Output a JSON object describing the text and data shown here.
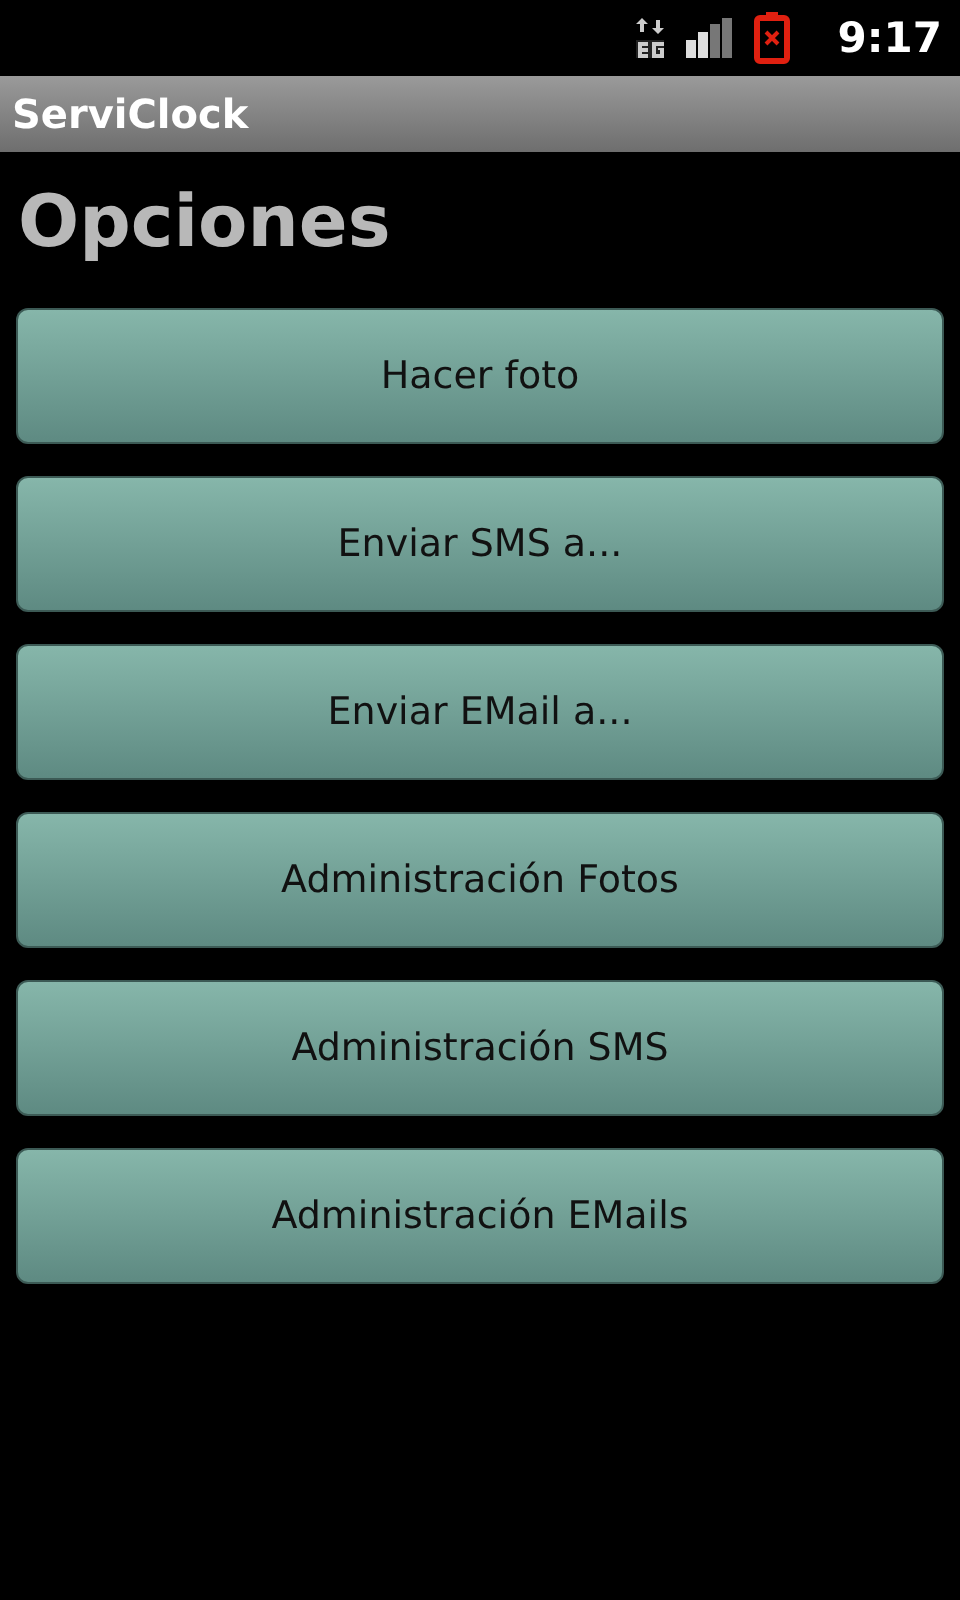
{
  "status_bar": {
    "time": "9:17"
  },
  "app_bar": {
    "title": "ServiClock"
  },
  "heading": "Opciones",
  "buttons": [
    {
      "label": "Hacer foto"
    },
    {
      "label": "Enviar SMS a..."
    },
    {
      "label": "Enviar EMail a..."
    },
    {
      "label": "Administración Fotos"
    },
    {
      "label": "Administración SMS"
    },
    {
      "label": "Administración EMails"
    }
  ]
}
